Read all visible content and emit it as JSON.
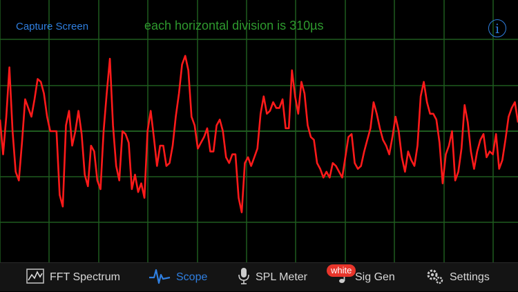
{
  "header": {
    "capture_label": "Capture Screen",
    "division_text": "each horizontal division is 310µs",
    "info_label": "i"
  },
  "scope": {
    "grid_color": "#1f5c1f",
    "trace_color": "#ff1a1a",
    "trace": [
      0.54,
      0.42,
      0.55,
      0.72,
      0.5,
      0.36,
      0.33,
      0.46,
      0.61,
      0.58,
      0.55,
      0.61,
      0.68,
      0.67,
      0.63,
      0.55,
      0.5,
      0.5,
      0.5,
      0.28,
      0.24,
      0.52,
      0.57,
      0.45,
      0.5,
      0.57,
      0.49,
      0.35,
      0.31,
      0.45,
      0.43,
      0.33,
      0.3,
      0.5,
      0.63,
      0.75,
      0.52,
      0.38,
      0.33,
      0.5,
      0.49,
      0.46,
      0.3,
      0.35,
      0.29,
      0.32,
      0.27,
      0.5,
      0.57,
      0.48,
      0.38,
      0.45,
      0.45,
      0.38,
      0.39,
      0.45,
      0.55,
      0.63,
      0.73,
      0.76,
      0.71,
      0.55,
      0.52,
      0.44,
      0.46,
      0.48,
      0.51,
      0.43,
      0.43,
      0.52,
      0.54,
      0.5,
      0.41,
      0.39,
      0.42,
      0.42,
      0.27,
      0.22,
      0.39,
      0.41,
      0.38,
      0.41,
      0.44,
      0.56,
      0.62,
      0.56,
      0.57,
      0.6,
      0.58,
      0.58,
      0.61,
      0.51,
      0.51,
      0.71,
      0.62,
      0.56,
      0.67,
      0.63,
      0.52,
      0.48,
      0.47,
      0.39,
      0.37,
      0.34,
      0.36,
      0.34,
      0.39,
      0.38,
      0.36,
      0.34,
      0.41,
      0.48,
      0.49,
      0.39,
      0.37,
      0.38,
      0.43,
      0.47,
      0.51,
      0.6,
      0.56,
      0.51,
      0.47,
      0.45,
      0.42,
      0.48,
      0.55,
      0.5,
      0.41,
      0.36,
      0.43,
      0.4,
      0.38,
      0.45,
      0.62,
      0.67,
      0.6,
      0.56,
      0.56,
      0.54,
      0.46,
      0.32,
      0.42,
      0.45,
      0.5,
      0.33,
      0.36,
      0.44,
      0.59,
      0.53,
      0.43,
      0.37,
      0.43,
      0.47,
      0.49,
      0.41,
      0.43,
      0.42,
      0.49,
      0.37,
      0.4,
      0.47,
      0.55,
      0.58,
      0.6,
      0.53
    ]
  },
  "tabs": [
    {
      "label": "FFT Spectrum",
      "icon": "fft-spectrum-icon"
    },
    {
      "label": "Scope",
      "icon": "scope-waveform-icon"
    },
    {
      "label": "SPL Meter",
      "icon": "microphone-icon"
    },
    {
      "label": "Sig Gen",
      "icon": "music-note-icon",
      "badge": "white"
    },
    {
      "label": "Settings",
      "icon": "gears-icon"
    }
  ],
  "colors": {
    "accent": "#2f7fe0",
    "badge": "#e8352b"
  }
}
